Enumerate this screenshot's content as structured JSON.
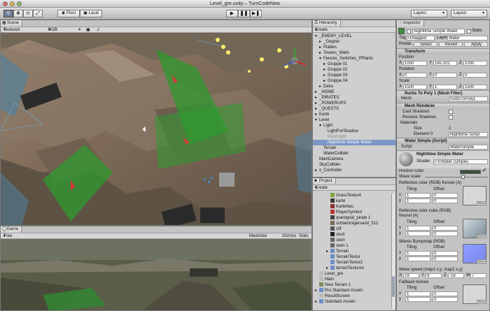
{
  "window": {
    "title": "Level_gre.unity – TurnCodeNew"
  },
  "toolbar": {
    "pivot": "Pivot",
    "local": "Local",
    "layers": "Layers",
    "layout": "Layout"
  },
  "scene": {
    "tab": "Scene",
    "mode": "Textured",
    "color": "RGB"
  },
  "game": {
    "tab": "Game",
    "aspect": "Free Aspect",
    "maximize": "Maximize on Play",
    "gizmos": "Gizmos",
    "stats": "Stats"
  },
  "hierarchy": {
    "tab": "Hierarchy",
    "create": "Create",
    "items": [
      {
        "label": "_ENEMY_LEVEL",
        "depth": 0,
        "open": true
      },
      {
        "label": "_Gegner",
        "depth": 1,
        "arrow": true
      },
      {
        "label": "Platten",
        "depth": 1,
        "arrow": true
      },
      {
        "label": "Towers_Walls",
        "depth": 1,
        "arrow": true
      },
      {
        "label": "Fences_Switches_PPlants",
        "depth": 1,
        "open": true
      },
      {
        "label": "Gruppe 01",
        "depth": 2,
        "arrow": true
      },
      {
        "label": "Gruppe 02",
        "depth": 2,
        "arrow": true
      },
      {
        "label": "Gruppe 03",
        "depth": 2,
        "arrow": true
      },
      {
        "label": "Gruppe 04",
        "depth": 2,
        "arrow": true
      },
      {
        "label": "Deko",
        "depth": 1,
        "arrow": true
      },
      {
        "label": "_HOME",
        "depth": 0,
        "arrow": true
      },
      {
        "label": "_PIRATES",
        "depth": 0,
        "arrow": true
      },
      {
        "label": "_POWERUPS",
        "depth": 0,
        "arrow": true
      },
      {
        "label": "_QUESTS",
        "depth": 0,
        "arrow": true
      },
      {
        "label": "Karte",
        "depth": 0,
        "arrow": true
      },
      {
        "label": "Level",
        "depth": 0,
        "open": true
      },
      {
        "label": "Light",
        "depth": 1,
        "open": true
      },
      {
        "label": "LightForShadow",
        "depth": 2
      },
      {
        "label": "Point light",
        "depth": 2,
        "dim": true
      },
      {
        "label": "Nighttime Simple Water",
        "depth": 2,
        "selected": true
      },
      {
        "label": "Terrain",
        "depth": 1
      },
      {
        "label": "WaterCollider",
        "depth": 1
      },
      {
        "label": "MainCamera",
        "depth": 0
      },
      {
        "label": "SkyCollider",
        "depth": 0
      },
      {
        "label": "z_Controller",
        "depth": 0,
        "arrow": true
      }
    ]
  },
  "project": {
    "tab": "Project",
    "create": "Create",
    "items": [
      {
        "label": "GrassTextur4",
        "depth": 2
      },
      {
        "label": "karte",
        "depth": 2
      },
      {
        "label": "KarteNeu",
        "depth": 2
      },
      {
        "label": "PlayerSymbol",
        "depth": 2
      },
      {
        "label": "questgoal_pirate 1",
        "depth": 2
      },
      {
        "label": "schlammigersand_512",
        "depth": 2
      },
      {
        "label": "siff",
        "depth": 2
      },
      {
        "label": "skull",
        "depth": 2
      },
      {
        "label": "stein",
        "depth": 2
      },
      {
        "label": "stein 1",
        "depth": 2
      },
      {
        "label": "Terrain",
        "depth": 2,
        "arrow": true
      },
      {
        "label": "TerrainTextur",
        "depth": 2
      },
      {
        "label": "TerrainTextur2",
        "depth": 2
      },
      {
        "label": "terrainTexturen",
        "depth": 2,
        "arrow": true
      },
      {
        "label": "Level_gre",
        "depth": 0
      },
      {
        "label": "Main",
        "depth": 0
      },
      {
        "label": "New Terrain 1",
        "depth": 0
      },
      {
        "label": "Pro Standard Assets",
        "depth": 0,
        "arrow": true
      },
      {
        "label": "ResultScreen",
        "depth": 0
      },
      {
        "label": "Standard Assets",
        "depth": 0,
        "arrow": true
      }
    ]
  },
  "inspector": {
    "tab": "Inspector",
    "object_name": "Nighttime Simple Water",
    "static_label": "Static",
    "tag_label": "Tag",
    "tag_value": "Untagged",
    "layer_label": "Layer",
    "layer_value": "Water",
    "prefab_label": "Prefab",
    "select": "Select",
    "revert": "Revert",
    "apply": "Apply",
    "transform": {
      "title": "Transform",
      "position": "Position",
      "rotation": "Rotation",
      "scale": "Scale",
      "pos": [
        "1000",
        "165.202",
        "1000"
      ],
      "rot": [
        "0",
        "0",
        "0"
      ],
      "scl": [
        "1500",
        "1",
        "1500"
      ]
    },
    "nurbs": {
      "title": "Nurbs To Poly 1 (Mesh Filter)",
      "mesh_label": "Mesh",
      "mesh_value": "nurbsToPoly1"
    },
    "renderer": {
      "title": "Mesh Renderer",
      "cast": "Cast Shadows",
      "receive": "Receive Shadows",
      "materials": "Materials",
      "size_label": "Size",
      "size_value": "1",
      "element_label": "Element 0",
      "element_value": "Nighttime Simpl"
    },
    "water": {
      "title": "Water Simple (Script)",
      "script_label": "Script",
      "script_value": "WaterSimple"
    },
    "material": {
      "name": "Nighttime Simple Water",
      "shader_label": "Shader",
      "shader_value": "FX/Water (simple)",
      "horizon": "Horizon color",
      "wavescale": "Wave scale",
      "refl_fresnel": "Reflective color (RGB) fresnel (A)",
      "refl_cube": "Reflective color cube (RGB) fresnel (A)",
      "bump": "Waves Bumpmap (RGB)",
      "wavespeed": "Wave speed (map1 x,y; map2 x,y)",
      "wavespeed_vals": [
        "19",
        "9",
        "-16",
        "7"
      ],
      "fallback": "Fallback texture",
      "tiling": "Tiling",
      "offset": "Offset",
      "t1": "1",
      "o0": "0",
      "select": "Select"
    }
  },
  "colors": {
    "selection": "#7c97c6",
    "trigger": "#2f9a2f"
  }
}
